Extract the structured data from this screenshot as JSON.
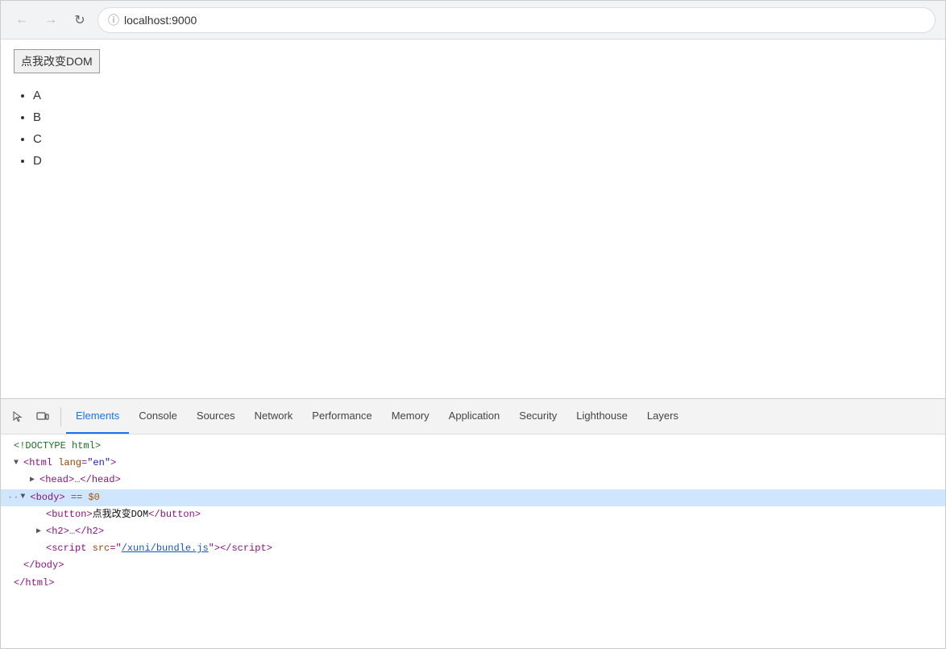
{
  "browser": {
    "back_disabled": true,
    "forward_disabled": true,
    "url": "localhost:9000"
  },
  "page": {
    "button_label": "点我改变DOM",
    "list_items": [
      "A",
      "B",
      "C",
      "D"
    ]
  },
  "devtools": {
    "tabs": [
      {
        "id": "elements",
        "label": "Elements",
        "active": true
      },
      {
        "id": "console",
        "label": "Console",
        "active": false
      },
      {
        "id": "sources",
        "label": "Sources",
        "active": false
      },
      {
        "id": "network",
        "label": "Network",
        "active": false
      },
      {
        "id": "performance",
        "label": "Performance",
        "active": false
      },
      {
        "id": "memory",
        "label": "Memory",
        "active": false
      },
      {
        "id": "application",
        "label": "Application",
        "active": false
      },
      {
        "id": "security",
        "label": "Security",
        "active": false
      },
      {
        "id": "lighthouse",
        "label": "Lighthouse",
        "active": false
      },
      {
        "id": "layers",
        "label": "Layers",
        "active": false
      }
    ],
    "dom_lines": [
      {
        "indent": 0,
        "content": "doctype",
        "highlighted": false
      },
      {
        "indent": 0,
        "content": "html_open",
        "highlighted": false
      },
      {
        "indent": 1,
        "content": "head_collapsed",
        "highlighted": false
      },
      {
        "indent": 1,
        "content": "body_highlighted",
        "highlighted": true
      },
      {
        "indent": 2,
        "content": "button_line",
        "highlighted": false
      },
      {
        "indent": 2,
        "content": "h2_collapsed",
        "highlighted": false
      },
      {
        "indent": 2,
        "content": "script_line",
        "highlighted": false
      },
      {
        "indent": 1,
        "content": "body_close",
        "highlighted": false
      },
      {
        "indent": 0,
        "content": "html_close",
        "highlighted": false
      }
    ]
  }
}
